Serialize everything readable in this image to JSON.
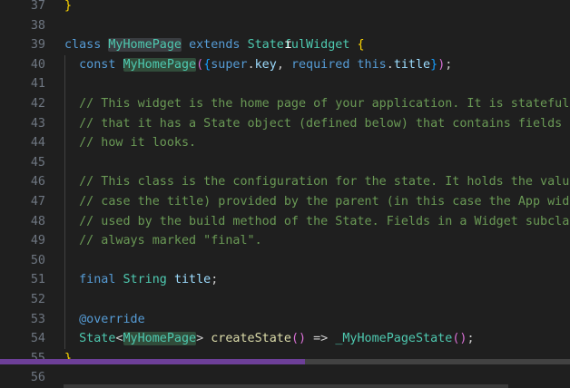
{
  "editor": {
    "lines": [
      {
        "n": "37",
        "tokens": [
          {
            "t": "}",
            "c": "p1"
          }
        ]
      },
      {
        "n": "38",
        "tokens": []
      },
      {
        "n": "39",
        "tokens": [
          {
            "t": "class ",
            "c": "kw"
          },
          {
            "t": "MyHomePage",
            "c": "cls hl-word"
          },
          {
            "t": " ",
            "c": ""
          },
          {
            "t": "extends ",
            "c": "kw"
          },
          {
            "t": "StatefulWidget",
            "c": "cls"
          },
          {
            "t": " ",
            "c": ""
          },
          {
            "t": "{",
            "c": "p1"
          }
        ]
      },
      {
        "n": "40",
        "tokens": [
          {
            "t": "  ",
            "c": ""
          },
          {
            "t": "const ",
            "c": "kw"
          },
          {
            "t": "MyHomePage",
            "c": "cls hl-match"
          },
          {
            "t": "(",
            "c": "p2"
          },
          {
            "t": "{",
            "c": "p3"
          },
          {
            "t": "super",
            "c": "kw"
          },
          {
            "t": ".",
            "c": ""
          },
          {
            "t": "key",
            "c": "var"
          },
          {
            "t": ", ",
            "c": ""
          },
          {
            "t": "required ",
            "c": "kw"
          },
          {
            "t": "this",
            "c": "kw"
          },
          {
            "t": ".",
            "c": ""
          },
          {
            "t": "title",
            "c": "var"
          },
          {
            "t": "}",
            "c": "p3"
          },
          {
            "t": ")",
            "c": "p2"
          },
          {
            "t": ";",
            "c": ""
          }
        ]
      },
      {
        "n": "41",
        "tokens": []
      },
      {
        "n": "42",
        "tokens": [
          {
            "t": "  // This widget is the home page of your application. It is stateful, meaning",
            "c": "cm"
          }
        ]
      },
      {
        "n": "43",
        "tokens": [
          {
            "t": "  // that it has a State object (defined below) that contains fields that affect",
            "c": "cm"
          }
        ]
      },
      {
        "n": "44",
        "tokens": [
          {
            "t": "  // how it looks.",
            "c": "cm"
          }
        ]
      },
      {
        "n": "45",
        "tokens": []
      },
      {
        "n": "46",
        "tokens": [
          {
            "t": "  // This class is the configuration for the state. It holds the values (in this",
            "c": "cm"
          }
        ]
      },
      {
        "n": "47",
        "tokens": [
          {
            "t": "  // case the title) provided by the parent (in this case the App widget) and",
            "c": "cm"
          }
        ]
      },
      {
        "n": "48",
        "tokens": [
          {
            "t": "  // used by the build method of the State. Fields in a Widget subclass are",
            "c": "cm"
          }
        ]
      },
      {
        "n": "49",
        "tokens": [
          {
            "t": "  // always marked \"final\".",
            "c": "cm"
          }
        ]
      },
      {
        "n": "50",
        "tokens": []
      },
      {
        "n": "51",
        "tokens": [
          {
            "t": "  ",
            "c": ""
          },
          {
            "t": "final ",
            "c": "kw"
          },
          {
            "t": "String",
            "c": "cls"
          },
          {
            "t": " ",
            "c": ""
          },
          {
            "t": "title",
            "c": "var"
          },
          {
            "t": ";",
            "c": ""
          }
        ]
      },
      {
        "n": "52",
        "tokens": []
      },
      {
        "n": "53",
        "tokens": [
          {
            "t": "  @override",
            "c": "kw"
          }
        ]
      },
      {
        "n": "54",
        "tokens": [
          {
            "t": "  ",
            "c": ""
          },
          {
            "t": "State",
            "c": "cls"
          },
          {
            "t": "<",
            "c": ""
          },
          {
            "t": "MyHomePage",
            "c": "cls hl-match"
          },
          {
            "t": "> ",
            "c": ""
          },
          {
            "t": "createState",
            "c": "fn"
          },
          {
            "t": "()",
            "c": "p2"
          },
          {
            "t": " => ",
            "c": ""
          },
          {
            "t": "_MyHomePageState",
            "c": "cls"
          },
          {
            "t": "()",
            "c": "p2"
          },
          {
            "t": ";",
            "c": ""
          }
        ]
      },
      {
        "n": "55",
        "tokens": [
          {
            "t": "}",
            "c": "p1"
          }
        ]
      },
      {
        "n": "56",
        "tokens": []
      }
    ]
  }
}
